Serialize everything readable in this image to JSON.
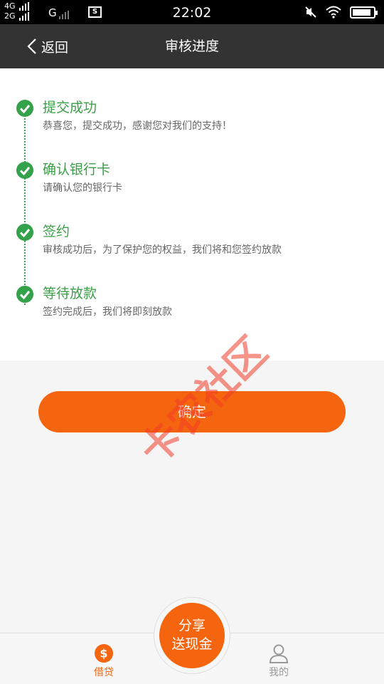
{
  "status_bar": {
    "net1": "4G",
    "net2": "2G",
    "net3": "G",
    "s_icon": "S",
    "time": "22:02",
    "icons": [
      "mute-icon",
      "wifi-icon",
      "battery-icon"
    ]
  },
  "header": {
    "back_label": "返回",
    "title": "审核进度"
  },
  "steps": [
    {
      "title": "提交成功",
      "desc": "恭喜您，提交成功，感谢您对我们的支持！"
    },
    {
      "title": "确认银行卡",
      "desc": "请确认您的银行卡"
    },
    {
      "title": "签约",
      "desc": "审核成功后，为了保护您的权益，我们将和您签约放款"
    },
    {
      "title": "等待放款",
      "desc": "签约完成后，我们将即刻放款"
    }
  ],
  "confirm_label": "确定",
  "watermark": "卡农社区",
  "bottom_nav": {
    "loans_label": "借贷",
    "loans_icon_text": "$",
    "share_line1": "分享",
    "share_line2": "送现金",
    "mine_label": "我的"
  },
  "colors": {
    "accent": "#f5650f",
    "success": "#34a24a",
    "header_bg": "#333333"
  }
}
